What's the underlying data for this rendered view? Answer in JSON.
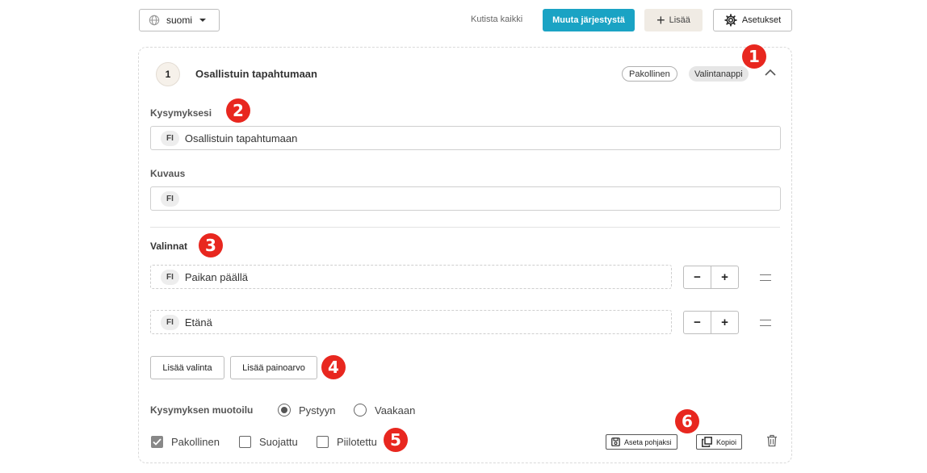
{
  "toolbar": {
    "language": "suomi",
    "collapse_all": "Kutista kaikki",
    "reorder": "Muuta järjestystä",
    "add": "Lisää",
    "settings": "Asetukset"
  },
  "question": {
    "number": "1",
    "title": "Osallistuin tapahtumaan",
    "badge_required": "Pakollinen",
    "badge_type": "Valintanappi",
    "question_label": "Kysymyksesi",
    "question_lang": "FI",
    "question_value": "Osallistuin tapahtumaan",
    "description_label": "Kuvaus",
    "description_lang": "FI",
    "description_value": "",
    "choices_label": "Valinnat",
    "choices": [
      {
        "lang": "FI",
        "value": "Paikan päällä"
      },
      {
        "lang": "FI",
        "value": "Etänä"
      }
    ],
    "add_choice": "Lisää valinta",
    "add_weight": "Lisää painoarvo",
    "format_label": "Kysymyksen muotoilu",
    "format_options": [
      "Pystyyn",
      "Vaakaan"
    ],
    "format_selected": "Pystyyn",
    "checkboxes": [
      {
        "label": "Pakollinen",
        "checked": true
      },
      {
        "label": "Suojattu",
        "checked": false
      },
      {
        "label": "Piilotettu",
        "checked": false
      }
    ],
    "set_template": "Aseta pohjaksi",
    "copy": "Kopioi"
  },
  "markers": [
    "1",
    "2",
    "3",
    "4",
    "5",
    "6"
  ],
  "colors": {
    "accent": "#1aa3c4",
    "marker": "#e8271f",
    "add_bg": "#f0ebe4"
  },
  "icons": [
    "globe-icon",
    "chevron-down-icon",
    "plus-icon",
    "gear-icon",
    "chevron-up-icon",
    "drag-handle-icon",
    "save-icon",
    "copy-icon",
    "trash-icon"
  ]
}
